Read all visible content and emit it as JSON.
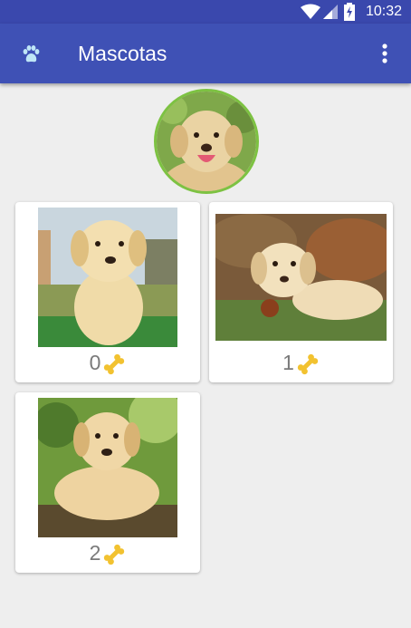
{
  "status_bar": {
    "time": "10:32"
  },
  "app_bar": {
    "title": "Mascotas",
    "logo_icon": "paw-icon",
    "menu_icon": "more-vert-icon"
  },
  "colors": {
    "primary": "#3f51b5",
    "primary_dark": "#3a48ad",
    "avatar_border": "#7dc242",
    "background": "#eeeeee"
  },
  "profile": {
    "photo": "labrador-puppy-smiling"
  },
  "pets": [
    {
      "count": "0",
      "icon": "bone-icon",
      "photo": "labrador-puppy-sitting"
    },
    {
      "count": "1",
      "icon": "bone-icon",
      "photo": "labrador-puppy-lying-leaves"
    },
    {
      "count": "2",
      "icon": "bone-icon",
      "photo": "labrador-puppy-on-log"
    }
  ]
}
